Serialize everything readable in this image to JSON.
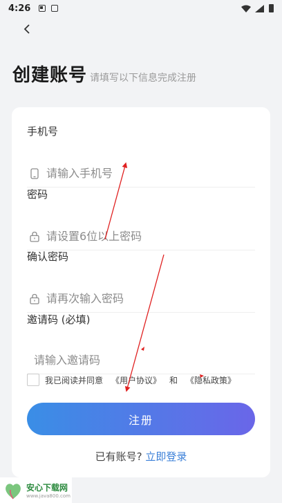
{
  "status_bar": {
    "time": "4:26"
  },
  "header": {
    "back_icon": "chevron-left",
    "title": "创建账号",
    "subtitle": "请填写以下信息完成注册"
  },
  "form": {
    "phone": {
      "label": "手机号",
      "placeholder": "请输入手机号",
      "icon": "phone-icon"
    },
    "password": {
      "label": "密码",
      "placeholder": "请设置6位以上密码",
      "icon": "lock-icon"
    },
    "confirm": {
      "label": "确认密码",
      "placeholder": "请再次输入密码",
      "icon": "lock-icon"
    },
    "invite": {
      "label": "邀请码 (必填)",
      "placeholder": "请输入邀请码"
    }
  },
  "agreement": {
    "prefix": "我已阅读并同意",
    "user_agreement": "《用户协议》",
    "and": "和",
    "privacy_policy": "《隐私政策》",
    "checked": false
  },
  "register_button": "注册",
  "login": {
    "prompt": "已有账号?",
    "link": "立即登录"
  },
  "watermark": {
    "name": "安心下载网",
    "url": "www.java800.com",
    "logo_text": "安心\n免费"
  },
  "colors": {
    "accent_start": "#3a8ee6",
    "accent_end": "#6a66e8",
    "link": "#3a7fd8",
    "annotation": "#e02020"
  }
}
